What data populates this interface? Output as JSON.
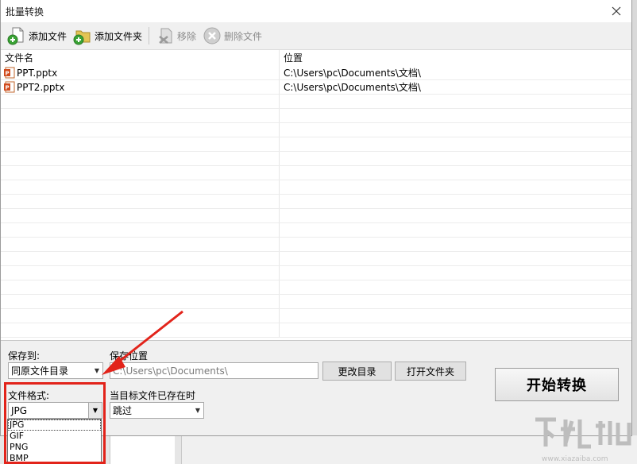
{
  "window": {
    "title": "批量转换"
  },
  "toolbar": {
    "add_file": "添加文件",
    "add_folder": "添加文件夹",
    "remove": "移除",
    "delete_file": "删除文件"
  },
  "list": {
    "headers": {
      "name": "文件名",
      "location": "位置"
    },
    "rows": [
      {
        "name": "PPT.pptx",
        "location": "C:\\Users\\pc\\Documents\\文档\\"
      },
      {
        "name": "PPT2.pptx",
        "location": "C:\\Users\\pc\\Documents\\文档\\"
      }
    ]
  },
  "options": {
    "save_to_label": "保存到:",
    "save_to_value": "同原文件目录",
    "save_location_label": "保存位置",
    "save_location_value": "C:\\Users\\pc\\Documents\\",
    "change_dir": "更改目录",
    "open_folder": "打开文件夹",
    "format_label": "文件格式:",
    "format_value": "JPG",
    "format_options": [
      "JPG",
      "GIF",
      "PNG",
      "BMP"
    ],
    "exists_label": "当目标文件已存在时",
    "exists_value": "跳过",
    "start": "开始转换"
  },
  "colors": {
    "highlight": "#e2231a",
    "icon_green": "#3aa335",
    "icon_folder": "#e3c454"
  },
  "watermark": {
    "text": "下载吧",
    "url": "www.xiazaiba.com"
  }
}
